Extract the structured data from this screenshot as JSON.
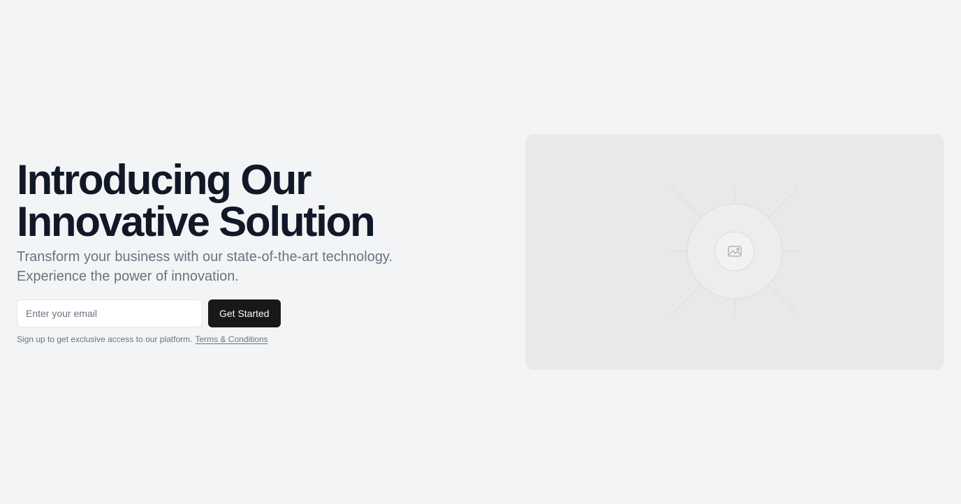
{
  "hero": {
    "headline_line1": "Introducing Our",
    "headline_line2": "Innovative Solution",
    "subtitle_line1": "Transform your business with our state-of-the-art technology.",
    "subtitle_line2": "Experience the power of innovation.",
    "email_placeholder": "Enter your email",
    "email_value": "",
    "cta_label": "Get Started",
    "fineprint_text": "Sign up to get exclusive access to our platform.",
    "terms_link_label": "Terms & Conditions"
  },
  "media": {
    "icon": "image-placeholder-icon"
  },
  "colors": {
    "background": "#f3f4f6",
    "headline": "#111827",
    "muted_text": "#6b7280",
    "button_bg": "#18181b",
    "button_text": "#fafafa",
    "media_bg": "#e9e9e9"
  }
}
